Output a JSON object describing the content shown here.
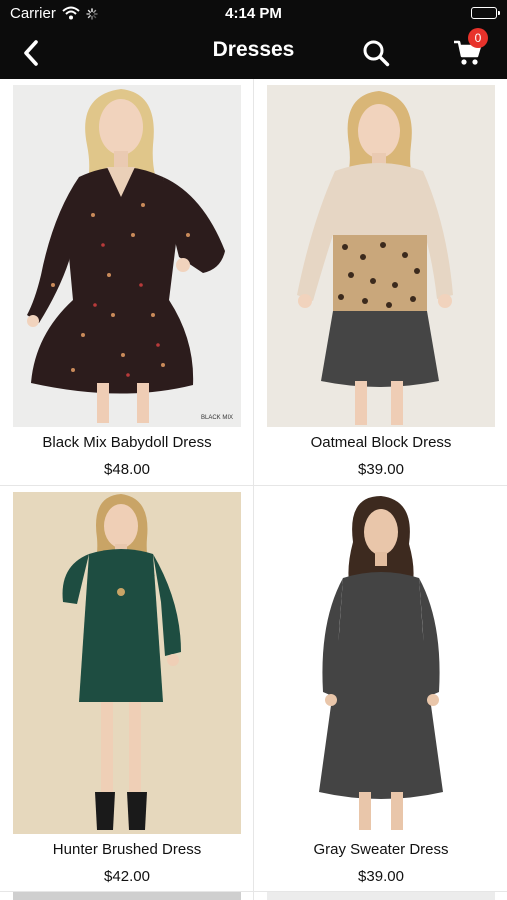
{
  "status_bar": {
    "carrier": "Carrier",
    "time": "4:14 PM"
  },
  "nav": {
    "title": "Dresses",
    "cart_count": "0"
  },
  "products": [
    {
      "name": "Black Mix Babydoll Dress",
      "price": "$48.00",
      "photo_tag": "BLACK MIX"
    },
    {
      "name": "Oatmeal Block Dress",
      "price": "$39.00"
    },
    {
      "name": "Hunter Brushed Dress",
      "price": "$42.00"
    },
    {
      "name": "Gray Sweater Dress",
      "price": "$39.00"
    }
  ],
  "colors": {
    "nav_bg": "#0c0c0c",
    "badge": "#e8322b"
  },
  "icons": [
    "back-chevron-icon",
    "search-icon",
    "cart-icon",
    "wifi-icon",
    "activity-spinner-icon",
    "battery-icon"
  ]
}
